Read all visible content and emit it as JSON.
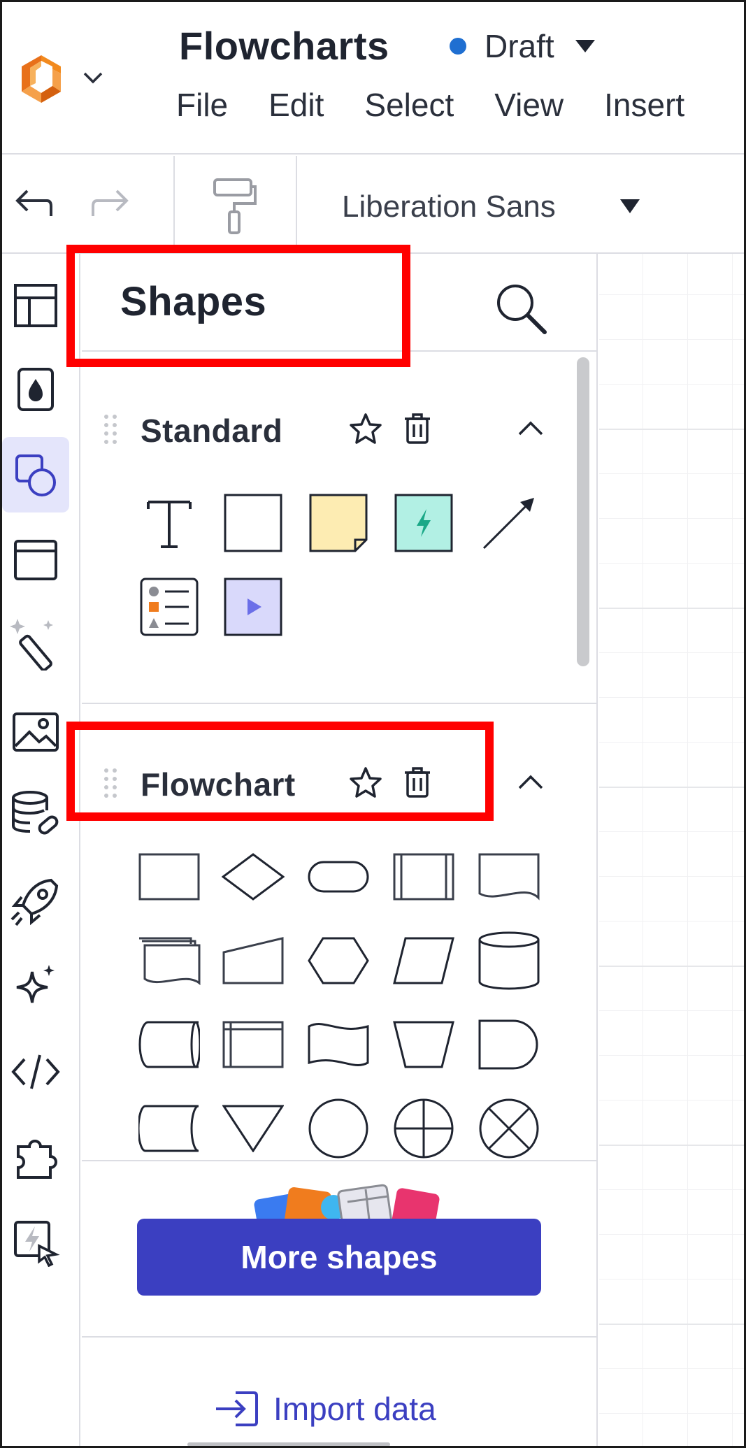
{
  "header": {
    "title": "Flowcharts",
    "status": "Draft",
    "status_color": "#1f6fd1",
    "menu": [
      "File",
      "Edit",
      "Select",
      "View",
      "Insert"
    ]
  },
  "toolbar": {
    "undo_icon": "undo-icon",
    "redo_icon": "redo-icon",
    "format_painter_icon": "paint-roller-icon",
    "font_family": "Liberation Sans"
  },
  "rail": {
    "items": [
      "layout-icon",
      "fill-drop-icon",
      "shapes-icon",
      "frame-icon",
      "magic-wand-icon",
      "image-icon",
      "data-link-icon",
      "rocket-icon",
      "sparkle-icon",
      "code-icon",
      "plugin-icon",
      "quick-action-icon"
    ],
    "active": "shapes-icon"
  },
  "panel": {
    "title": "Shapes",
    "sections": [
      {
        "name": "Standard",
        "shapes": [
          "text",
          "rectangle",
          "sticky-note",
          "action-block",
          "arrow",
          "list",
          "video"
        ]
      },
      {
        "name": "Flowchart",
        "shapes": [
          "process",
          "decision",
          "terminator",
          "predefined-process",
          "document",
          "multi-document",
          "manual-input",
          "preparation",
          "data",
          "database",
          "stored-data",
          "internal-storage",
          "paper-tape",
          "manual-operation",
          "delay",
          "direct-access-storage",
          "merge",
          "connector",
          "or",
          "summing-junction"
        ]
      }
    ],
    "more_shapes_label": "More shapes",
    "import_label": "Import data"
  },
  "colors": {
    "accent": "#3b3fc1",
    "annotation": "#ff0000",
    "sticky": "#fdecb2",
    "action": "#b2f0e4"
  }
}
